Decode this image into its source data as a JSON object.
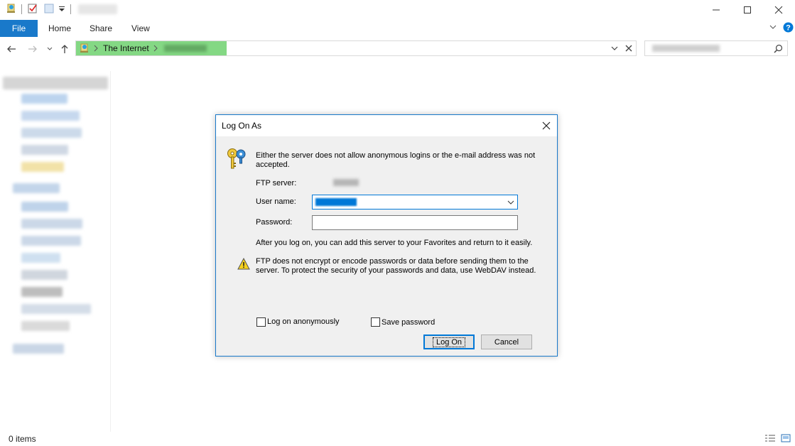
{
  "ribbon": {
    "file": "File",
    "tabs": [
      "Home",
      "Share",
      "View"
    ]
  },
  "address": {
    "crumbs": [
      "The Internet"
    ]
  },
  "statusbar": {
    "items_text": "0 items"
  },
  "dialog": {
    "title": "Log On As",
    "intro": "Either the server does not allow anonymous logins or the e-mail address was not accepted.",
    "ftp_server_label": "FTP server:",
    "user_name_label": "User name:",
    "password_label": "Password:",
    "password_value": "",
    "favorites_note": "After you log on, you can add this server to your Favorites and return to it easily.",
    "warning": "FTP does not encrypt or encode passwords or data before sending them to the server.  To protect the security of your passwords and data, use WebDAV instead.",
    "anon_label": "Log on anonymously",
    "anon_checked": false,
    "save_label": "Save password",
    "save_checked": false,
    "logon_button": "Log On",
    "cancel_button": "Cancel"
  },
  "colors": {
    "accent": "#1979ca",
    "address_highlight": "#84d884",
    "dialog_bg": "#f0f0f0",
    "help": "#0078d7"
  }
}
